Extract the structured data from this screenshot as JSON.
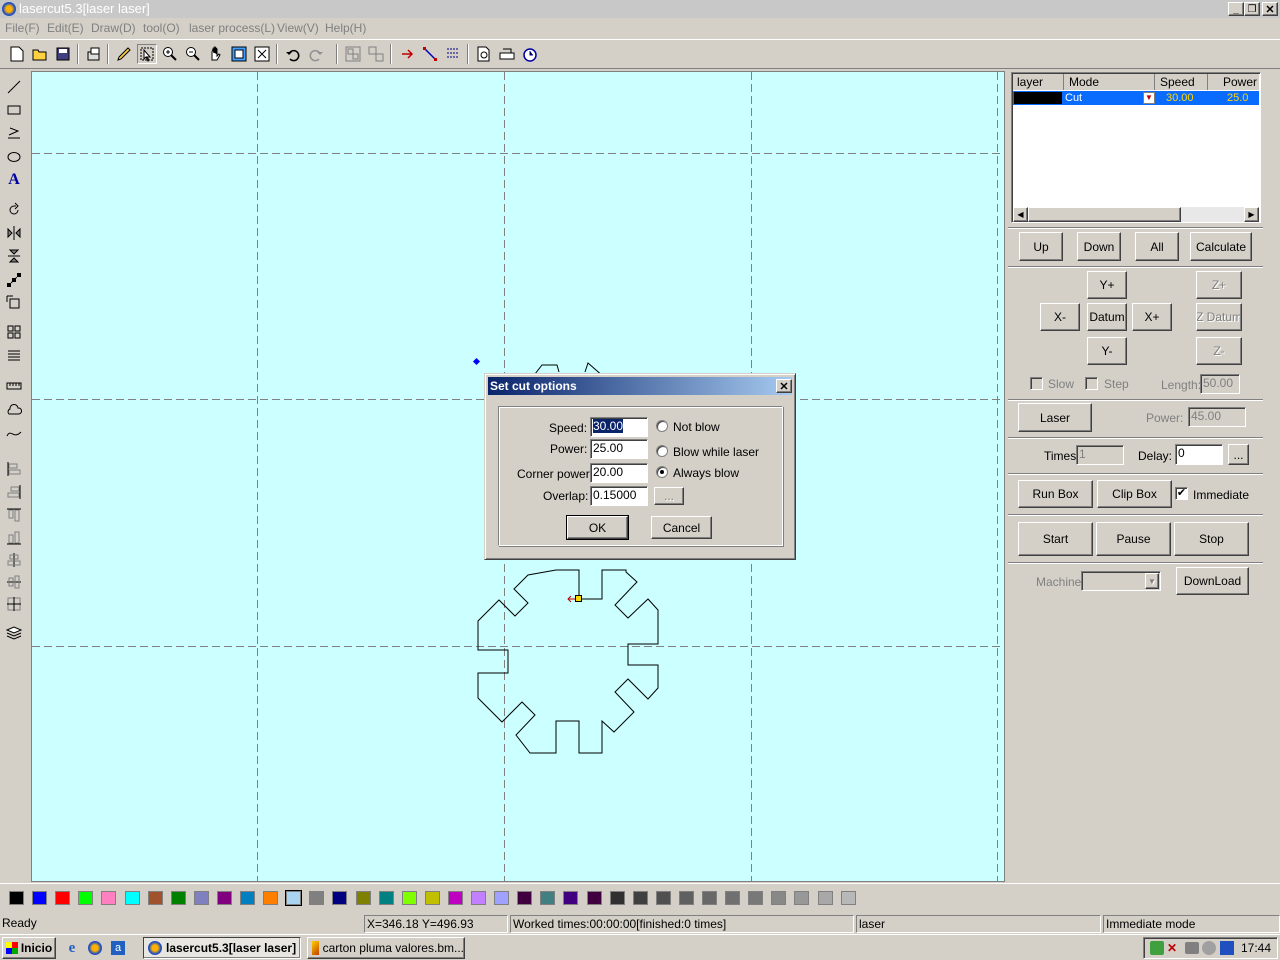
{
  "window": {
    "title": "lasercut5.3[laser laser]"
  },
  "menu": [
    "File(F)",
    "Edit(E)",
    "Draw(D)",
    "tool(O)",
    "laser process(L)",
    "View(V)",
    "Help(H)"
  ],
  "toolbar": {
    "icons": [
      "new-icon",
      "open-icon",
      "save-icon",
      "import-icon",
      "pen-icon",
      "select-icon",
      "zoom-in-icon",
      "zoom-out-icon",
      "pan-icon",
      "zoom-page-icon",
      "zoom-fit-icon",
      "undo-icon",
      "redo-icon",
      "group-icon",
      "ungroup-icon",
      "cut-path-icon",
      "line-edit-icon",
      "grid-icon",
      "preview-icon",
      "machine-icon",
      "clock-icon"
    ]
  },
  "layer_table": {
    "headers": [
      "layer",
      "Mode",
      "Speed",
      "Power"
    ],
    "rows": [
      {
        "color": "#000000",
        "mode": "Cut",
        "speed": "30.00",
        "power": "25.0"
      }
    ]
  },
  "panel": {
    "up": "Up",
    "down": "Down",
    "all": "All",
    "calculate": "Calculate",
    "y_plus": "Y+",
    "y_minus": "Y-",
    "x_minus": "X-",
    "x_plus": "X+",
    "datum": "Datum",
    "z_plus": "Z+",
    "z_datum": "Z Datum",
    "z_minus": "Z-",
    "slow": "Slow",
    "step": "Step",
    "length_label": "Length:",
    "length_value": "50.00",
    "laser": "Laser",
    "power_label": "Power:",
    "power_value": "45.00",
    "times_label": "Times:",
    "times_value": "1",
    "delay_label": "Delay:",
    "delay_value": "0",
    "more": "...",
    "run_box": "Run Box",
    "clip_box": "Clip Box",
    "immediate": "Immediate",
    "immediate_checked": true,
    "start": "Start",
    "pause": "Pause",
    "stop": "Stop",
    "machine_label": "Machine:",
    "machine_value": "",
    "download": "DownLoad"
  },
  "dialog": {
    "title": "Set cut options",
    "speed_label": "Speed:",
    "speed_value": "30.00",
    "power_label": "Power:",
    "power_value": "25.00",
    "corner_label": "Corner power:",
    "corner_value": "20.00",
    "overlap_label": "Overlap:",
    "overlap_value": "0.15000",
    "ellipsis": "...",
    "not_blow": "Not blow",
    "blow_while": "Blow while laser",
    "always_blow": "Always blow",
    "selected_option": "Always blow",
    "ok": "OK",
    "cancel": "Cancel"
  },
  "palette": [
    "#000000",
    "#0000ff",
    "#ff0000",
    "#00ff00",
    "#ff80c0",
    "#00ffff",
    "#a0522d",
    "#008000",
    "#8080c0",
    "#800080",
    "#0080c0",
    "#ff8000",
    "#aad4f0",
    "#808080",
    "#000080",
    "#808000",
    "#008080",
    "#80ff00",
    "#c0c000",
    "#c000c0",
    "#c080ff",
    "#a0a0ff",
    "#400040",
    "#408080",
    "#400080",
    "#400040",
    "#303030",
    "#404040",
    "#505050",
    "#606060",
    "#686868",
    "#707070",
    "#787878",
    "#888888",
    "#989898",
    "#a8a8a8",
    "#b8b8b8"
  ],
  "statusbar": {
    "ready": "Ready",
    "coords": "X=346.18 Y=496.93",
    "worked": "Worked times:00:00:00[finished:0 times]",
    "layer": "laser",
    "mode": "Immediate mode"
  },
  "taskbar": {
    "start": "Inicio",
    "task1": "lasercut5.3[laser laser]",
    "task2": "carton pluma valores.bm...",
    "clock": "17:44"
  }
}
